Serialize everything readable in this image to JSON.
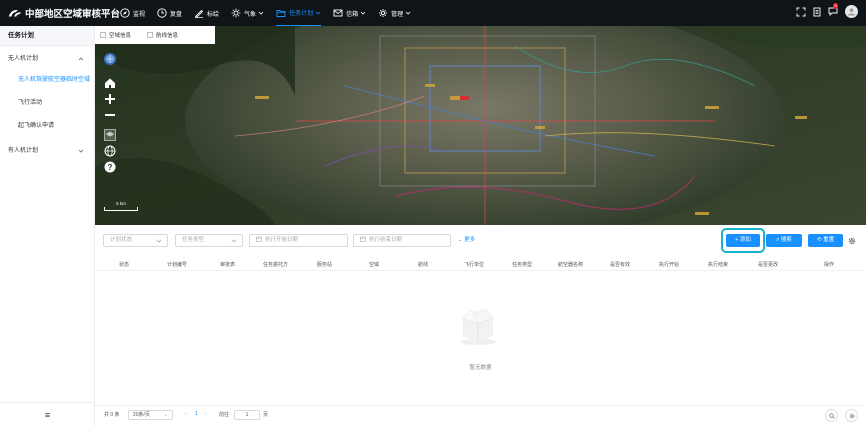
{
  "app": {
    "title": "中部地区空域审核平台"
  },
  "nav": [
    {
      "label": "监视",
      "icon": "compass-icon"
    },
    {
      "label": "复盘",
      "icon": "clock-icon"
    },
    {
      "label": "标绘",
      "icon": "pen-icon"
    },
    {
      "label": "气象",
      "icon": "sun-icon",
      "dropdown": true
    },
    {
      "label": "任务计划",
      "icon": "folder-icon",
      "dropdown": true,
      "active": true
    },
    {
      "label": "信箱",
      "icon": "mail-icon",
      "dropdown": true
    },
    {
      "label": "管理",
      "icon": "gear-icon",
      "dropdown": true
    }
  ],
  "header_right": {
    "badge": "5"
  },
  "sidebar": {
    "title": "任务计划",
    "groups": [
      {
        "label": "无人机计划",
        "items": [
          "无人机驾驶航空器临时空域",
          "飞行活动",
          "起飞确认申请"
        ]
      },
      {
        "label": "有人机计划",
        "items": []
      }
    ],
    "collapse_glyph": "≡"
  },
  "map": {
    "layers": [
      "空域信息",
      "航线信息"
    ],
    "scale_label": "5 km"
  },
  "filters": {
    "status_placeholder": "计划状态",
    "type_placeholder": "任务类型",
    "start_placeholder": "执行开始日期",
    "end_placeholder": "执行结束日期",
    "more": "更多",
    "add": "添加",
    "search": "搜索",
    "reset": "重置"
  },
  "table": {
    "columns": [
      "状态",
      "计划编号",
      "审批表",
      "任务委托方",
      "服务站",
      "空域",
      "航线",
      "飞行单位",
      "任务类型",
      "航空器名称",
      "是否有效",
      "执行开始",
      "执行结束",
      "是否更改",
      "操作"
    ],
    "empty_text": "暂无数据"
  },
  "pager": {
    "total": "共 0 条",
    "page_size": "20条/页",
    "current": "1",
    "goto_label": "前往",
    "goto_value": "1",
    "page_unit": "页"
  }
}
